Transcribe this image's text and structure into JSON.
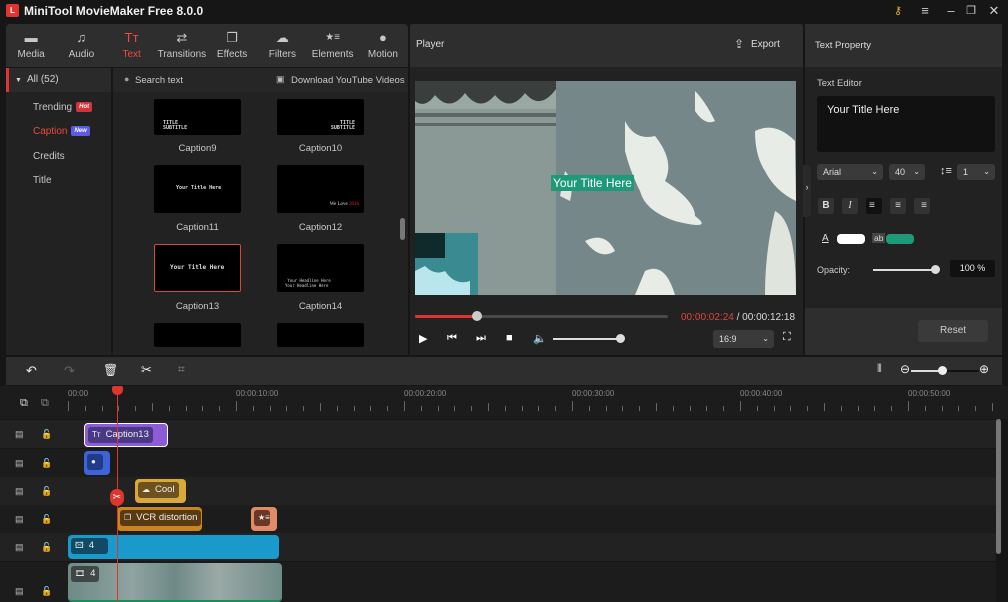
{
  "app": {
    "title": "MiniTool MovieMaker Free 8.0.0",
    "logo": "L",
    "window_buttons": [
      {
        "name": "key-icon",
        "glyph": "🔑"
      },
      {
        "name": "menu-icon",
        "glyph": "≡"
      },
      {
        "name": "minimize-icon",
        "glyph": "—"
      },
      {
        "name": "restore-icon",
        "glyph": "❐"
      },
      {
        "name": "close-icon",
        "glyph": "✕"
      }
    ]
  },
  "toolbar": {
    "tabs": [
      {
        "label": "Media",
        "icon": "folder-icon",
        "glyph": "▬"
      },
      {
        "label": "Audio",
        "icon": "music-icon",
        "glyph": "♫"
      },
      {
        "label": "Text",
        "icon": "text-icon",
        "glyph": "Tт",
        "active": true
      },
      {
        "label": "Transitions",
        "icon": "transitions-icon",
        "glyph": "⇄"
      },
      {
        "label": "Effects",
        "icon": "effects-icon",
        "glyph": "❐"
      },
      {
        "label": "Filters",
        "icon": "filters-icon",
        "glyph": "☁"
      },
      {
        "label": "Elements",
        "icon": "elements-icon",
        "glyph": "★≡"
      },
      {
        "label": "Motion",
        "icon": "motion-icon",
        "glyph": "●"
      }
    ]
  },
  "categories": {
    "all_label": "All (52)",
    "items": [
      {
        "label": "Trending",
        "badge": "Hot",
        "badge_color": "#d9303a"
      },
      {
        "label": "Caption",
        "badge": "New",
        "badge_color": "#5b5be8",
        "active": true
      },
      {
        "label": "Credits"
      },
      {
        "label": "Title"
      }
    ]
  },
  "library": {
    "search_placeholder": "Search text",
    "download_label": "Download YouTube Videos",
    "items": [
      {
        "label": "Caption9",
        "preview": "TITLE\nSUBTITLE"
      },
      {
        "label": "Caption10",
        "preview": "TITLE\nSUBTITLE"
      },
      {
        "label": "Caption11",
        "preview": "Your Title Here"
      },
      {
        "label": "Caption12",
        "preview": "We Love 2016"
      },
      {
        "label": "Caption13",
        "preview": "Your  Title Here",
        "selected": true
      },
      {
        "label": "Caption14",
        "preview": "Your Headline Here\nYour Headline Here"
      },
      {
        "label": "",
        "preview": ""
      },
      {
        "label": "",
        "preview": ""
      }
    ]
  },
  "player": {
    "title": "Player",
    "export_label": "Export",
    "caption_text": "Your Title Here",
    "current_time": "00:00:02:24",
    "separator": " / ",
    "total_time": "00:00:12:18",
    "progress_fraction": 0.245,
    "volume_fraction": 1.0,
    "aspect_ratio": "16:9"
  },
  "text_property": {
    "title": "Text Property",
    "editor_label": "Text Editor",
    "editor_value": "Your Title Here",
    "font": "Arial",
    "size": "40",
    "line_spacing": "1",
    "format_buttons": [
      {
        "name": "bold-button",
        "glyph": "B"
      },
      {
        "name": "italic-button",
        "glyph": "I"
      },
      {
        "name": "align-left-button",
        "glyph": "≡"
      },
      {
        "name": "align-center-button",
        "glyph": "≡"
      },
      {
        "name": "align-right-button",
        "glyph": "≡"
      }
    ],
    "text_color": "#ffffff",
    "bg_label": "ab",
    "bg_color": "#1f9a78",
    "opacity_label": "Opacity:",
    "opacity_value": "100 %",
    "opacity_fraction": 1.0,
    "reset_label": "Reset"
  },
  "timeline": {
    "zoom_fraction": 0.45,
    "ruler_labels": [
      "00:00",
      "00:00:10:00",
      "00:00:20:00",
      "00:00:30:00",
      "00:00:40:00",
      "00:00:50:00"
    ],
    "playhead_time": "00:00:02:24",
    "clips": [
      {
        "track": 0,
        "label": "Caption13",
        "icon": "Tт",
        "color": "#8b5cd6",
        "inner": "#4a3a86"
      },
      {
        "track": 1,
        "label": "",
        "icon": "●",
        "color": "#3e63d8",
        "inner": "#223a8a"
      },
      {
        "track": 2,
        "label": "Cool",
        "icon": "☁",
        "color": "#d9a83a",
        "inner": "#6d5220"
      },
      {
        "track": 3,
        "label": "VCR distortion",
        "icon": "❐",
        "color": "#c98620",
        "inner": "#5a3a10"
      },
      {
        "track": 3,
        "label": "",
        "icon": "★≡",
        "color": "#e08a68",
        "inner": "#6a3828"
      },
      {
        "track": 4,
        "label": "4",
        "icon": "🖾",
        "color": "#1a9acb",
        "inner": "#104a66"
      },
      {
        "track": 5,
        "label": "4",
        "icon": "🎞",
        "color": "#6e8a86",
        "inner": "#3a3a3a"
      }
    ]
  }
}
